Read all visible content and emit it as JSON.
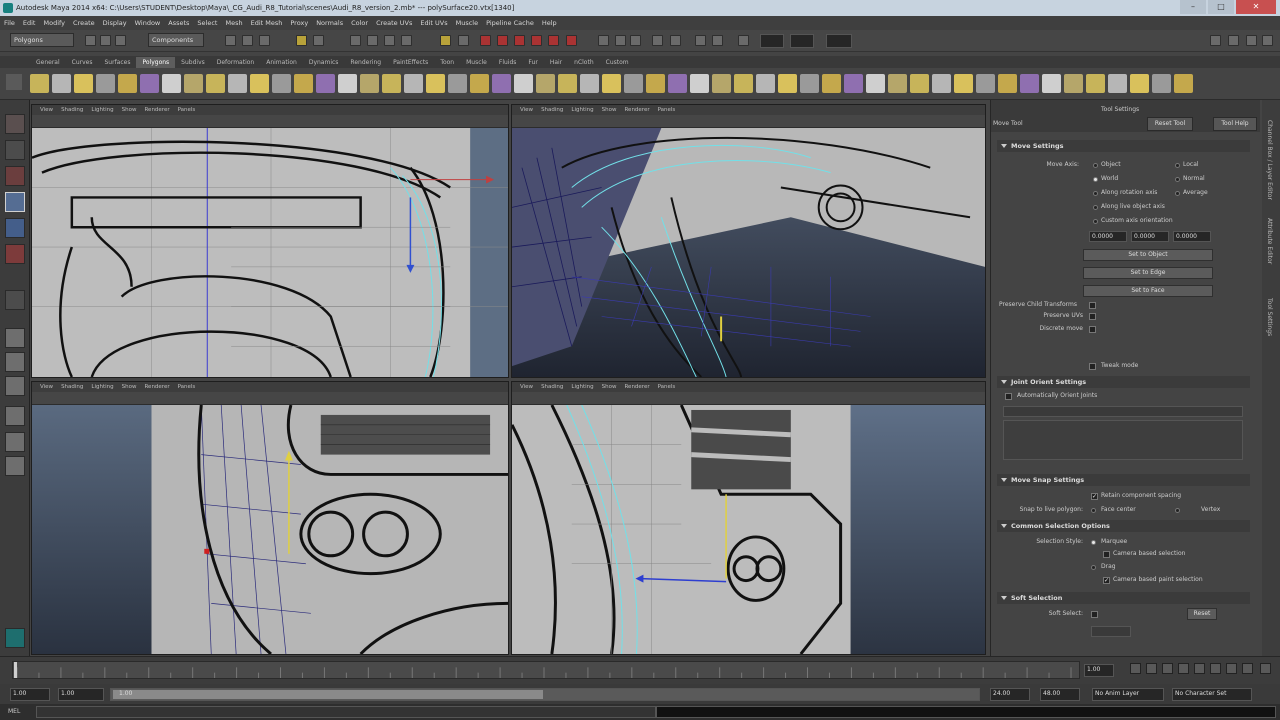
{
  "window": {
    "title": "Autodesk Maya 2014 x64: C:\\Users\\STUDENT\\Desktop\\Maya\\_CG_Audi_R8_Tutorial\\scenes\\Audi_R8_version_2.mb* --- polySurface20.vtx[1340]"
  },
  "menubar": [
    "File",
    "Edit",
    "Modify",
    "Create",
    "Display",
    "Window",
    "Assets",
    "Select",
    "Mesh",
    "Edit Mesh",
    "Proxy",
    "Normals",
    "Color",
    "Create UVs",
    "Edit UVs",
    "Muscle",
    "Pipeline Cache",
    "Help"
  ],
  "statusline": {
    "menuset": "Polygons",
    "mode": "Components"
  },
  "shelf_tabs": [
    "General",
    "Curves",
    "Surfaces",
    "Polygons",
    "Subdivs",
    "Deformation",
    "Animation",
    "Dynamics",
    "Rendering",
    "PaintEffects",
    "Toon",
    "Muscle",
    "Fluids",
    "Fur",
    "Hair",
    "nCloth",
    "Custom"
  ],
  "shelf_active": "Polygons",
  "viewport_menu": [
    "View",
    "Shading",
    "Lighting",
    "Show",
    "Renderer",
    "Panels"
  ],
  "attribute_editor": {
    "tool_title": "Move Tool",
    "tab_label": "Tool Settings",
    "reset_button": "Reset Tool",
    "help_button": "Tool Help",
    "move_settings": {
      "title": "Move Settings",
      "move_axis_label": "Move Axis:",
      "options": [
        "Object",
        "Local",
        "World",
        "Normal",
        "Along rotation axis",
        "Average",
        "Along live object axis",
        "Custom axis orientation"
      ],
      "values": [
        "0.0000",
        "0.0000",
        "0.0000"
      ],
      "set_to_object": "Set to Object",
      "set_to_edge": "Set to Edge",
      "set_to_face": "Set to Face",
      "preserve_child": "Preserve Child Transforms",
      "preserve_uvs": "Preserve UVs",
      "discrete_move": "Discrete move",
      "tweak_mode": "Tweak mode"
    },
    "joint_orient": {
      "title": "Joint Orient Settings",
      "auto_orient": "Automatically Orient Joints"
    },
    "move_snap": {
      "title": "Move Snap Settings",
      "retain_spacing": "Retain component spacing",
      "snap_live": "Snap to live polygon:",
      "face_center": "Face center",
      "vertex": "Vertex"
    },
    "common_selection": {
      "title": "Common Selection Options",
      "selection_style": "Selection Style:",
      "marquee": "Marquee",
      "camera_based": "Camera based selection",
      "drag": "Drag",
      "camera_paint": "Camera based paint selection"
    },
    "soft_selection": {
      "title": "Soft Selection",
      "soft_select": "Soft Select:",
      "reset": "Reset"
    }
  },
  "side_tabs": [
    "Channel Box / Layer Editor",
    "Attribute Editor",
    "Tool Settings"
  ],
  "time": {
    "start": "1.00",
    "current": "1.00",
    "range_start": "1.00",
    "range_left": "1.00",
    "range_end": "24.00",
    "end": "48.00",
    "anim_layer": "No Anim Layer",
    "char_set": "No Character Set",
    "ticks": [
      "2",
      "4",
      "6",
      "8",
      "10",
      "12",
      "14",
      "16",
      "18",
      "20",
      "22",
      "24"
    ]
  },
  "cmdline": {
    "label": "MEL"
  },
  "colors": {
    "accent": "#5d87b8",
    "wire": "#111111",
    "select": "#72e0e8",
    "bg": "#444444"
  }
}
